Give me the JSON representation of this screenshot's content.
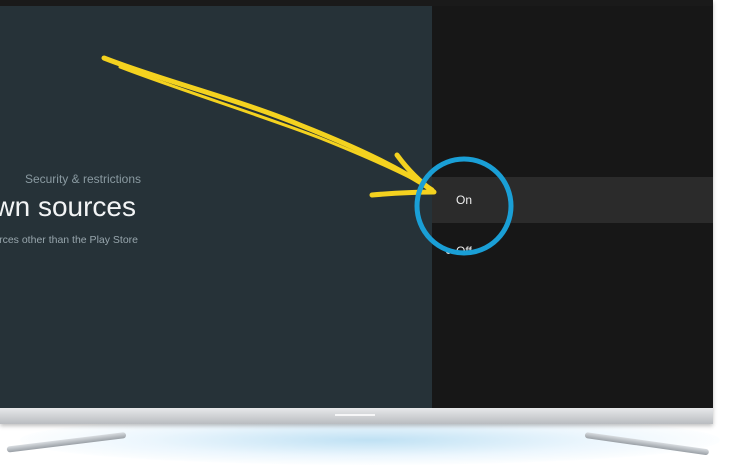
{
  "screen": {
    "breadcrumb": "Security & restrictions",
    "title": "Unknown sources",
    "description": "Allow installation of apps from sources other than the Play Store"
  },
  "options": [
    {
      "label": "On",
      "selected": true
    },
    {
      "label": "Off",
      "selected": false
    }
  ],
  "colors": {
    "left_panel": "#263238",
    "right_panel": "#171717",
    "highlight_row": "#2b2b2b",
    "annotation_arrow": "#f4d21f",
    "annotation_circle": "#1a9fd6"
  }
}
